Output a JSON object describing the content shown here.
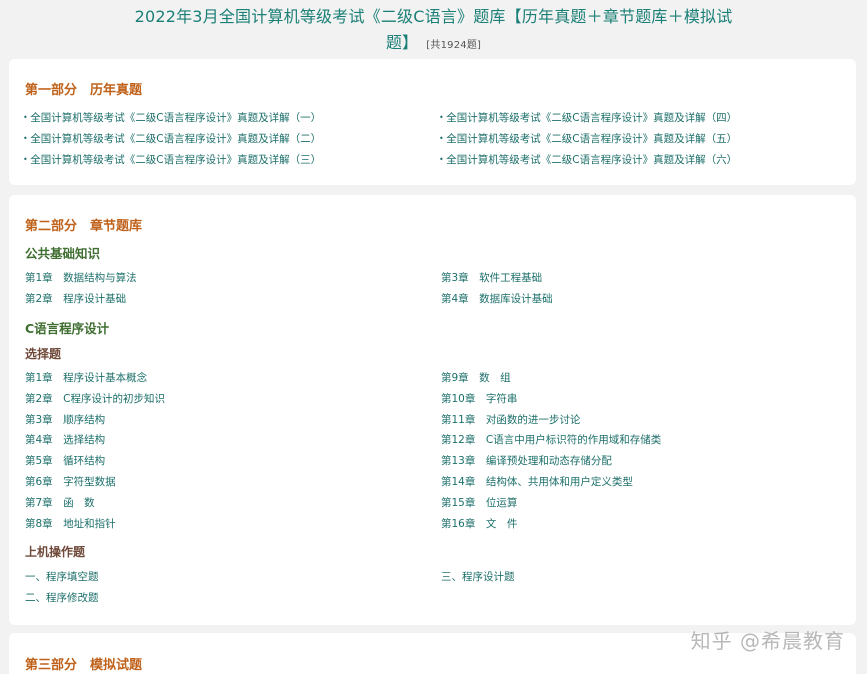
{
  "header": {
    "title_line1": "2022年3月全国计算机等级考试《二级C语言》题库【历年真题＋章节题库＋模拟试",
    "title_line2": "题】",
    "count": "[共1924题]"
  },
  "part1": {
    "title": "第一部分　历年真题",
    "left_items": [
      "全国计算机等级考试《二级C语言程序设计》真题及详解（一）",
      "全国计算机等级考试《二级C语言程序设计》真题及详解（二）",
      "全国计算机等级考试《二级C语言程序设计》真题及详解（三）"
    ],
    "right_items": [
      "全国计算机等级考试《二级C语言程序设计》真题及详解（四）",
      "全国计算机等级考试《二级C语言程序设计》真题及详解（五）",
      "全国计算机等级考试《二级C语言程序设计》真题及详解（六）"
    ]
  },
  "part2": {
    "title": "第二部分　章节题库",
    "public": {
      "heading": "公共基础知识",
      "left_items": [
        "第1章　数据结构与算法",
        "第2章　程序设计基础"
      ],
      "right_items": [
        "第3章　软件工程基础",
        "第4章　数据库设计基础"
      ]
    },
    "c_heading": "C语言程序设计",
    "choice": {
      "heading": "选择题",
      "left_items": [
        "第1章　程序设计基本概念",
        "第2章　C程序设计的初步知识",
        "第3章　顺序结构",
        "第4章　选择结构",
        "第5章　循环结构",
        "第6章　字符型数据",
        "第7章　函　数",
        "第8章　地址和指针"
      ],
      "right_items": [
        "第9章　数　组",
        "第10章　字符串",
        "第11章　对函数的进一步讨论",
        "第12章　C语言中用户标识符的作用域和存储类",
        "第13章　编译预处理和动态存储分配",
        "第14章　结构体、共用体和用户定义类型",
        "第15章　位运算",
        "第16章　文　件"
      ]
    },
    "operation": {
      "heading": "上机操作题",
      "left_items": [
        "一、程序填空题",
        "二、程序修改题"
      ],
      "right_items": [
        "三、程序设计题"
      ]
    }
  },
  "part3": {
    "title": "第三部分　模拟试题"
  },
  "watermark": "知乎 @希晨教育"
}
